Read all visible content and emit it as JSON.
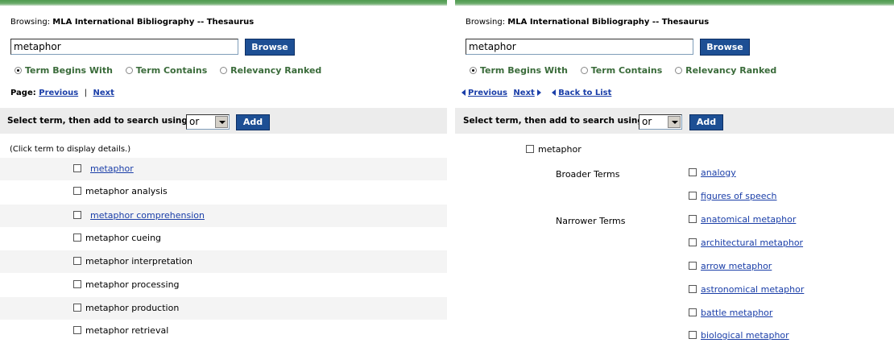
{
  "left": {
    "browsing_label": "Browsing:",
    "browsing_db": "MLA International Bibliography -- Thesaurus",
    "query": "metaphor",
    "browse_button": "Browse",
    "radio_options": [
      "Term Begins With",
      "Term Contains",
      "Relevancy Ranked"
    ],
    "selected_radio": "Term Begins With",
    "page_label": "Page:",
    "prev_link": "Previous",
    "next_link": "Next",
    "pager_sep": "|",
    "add_label": "Select term, then add to search using:",
    "operator": "or",
    "add_button": "Add",
    "hint": "(Click term to display details.)",
    "terms": [
      {
        "text": "metaphor",
        "link": true
      },
      {
        "text": "metaphor analysis",
        "link": false
      },
      {
        "text": "metaphor comprehension",
        "link": true
      },
      {
        "text": "metaphor cueing",
        "link": false
      },
      {
        "text": "metaphor interpretation",
        "link": false
      },
      {
        "text": "metaphor processing",
        "link": false
      },
      {
        "text": "metaphor production",
        "link": false
      },
      {
        "text": "metaphor retrieval",
        "link": false
      }
    ]
  },
  "right": {
    "browsing_label": "Browsing:",
    "browsing_db": "MLA International Bibliography -- Thesaurus",
    "query": "metaphor",
    "browse_button": "Browse",
    "radio_options": [
      "Term Begins With",
      "Term Contains",
      "Relevancy Ranked"
    ],
    "selected_radio": "Term Begins With",
    "prev_link": "Previous",
    "next_link": "Next",
    "back_link": "Back to List",
    "add_label": "Select term, then add to search using:",
    "operator": "or",
    "add_button": "Add",
    "main_term": "metaphor",
    "broader_label": "Broader Terms",
    "broader_terms": [
      "analogy",
      "figures of speech"
    ],
    "narrower_label": "Narrower Terms",
    "narrower_terms": [
      "anatomical metaphor",
      "architectural metaphor",
      "arrow metaphor",
      "astronomical metaphor",
      "battle metaphor",
      "biological metaphor"
    ]
  },
  "colors": {
    "accent_green": "#4f9a4f",
    "button_blue": "#1d4f94",
    "link_blue": "#1a3ea8",
    "radio_text_green": "#3a6b3a"
  }
}
